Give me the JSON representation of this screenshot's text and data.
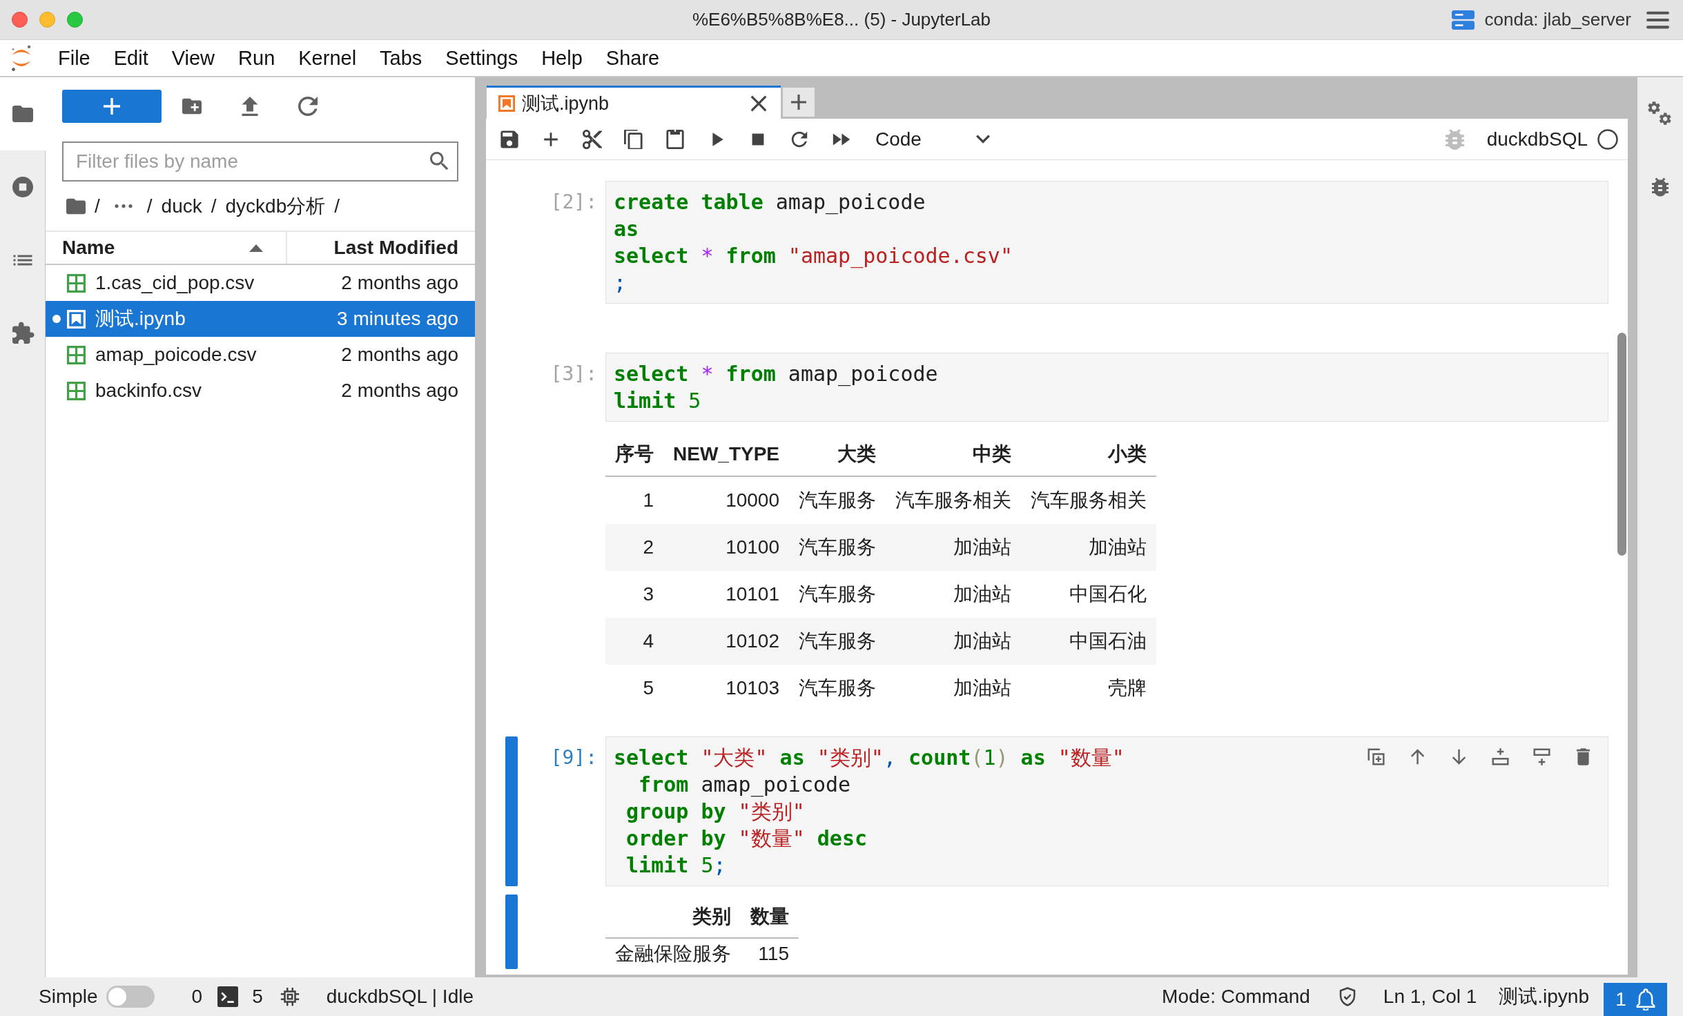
{
  "window": {
    "title": "%E6%B5%8B%E8... (5) - JupyterLab",
    "environment": "conda: jlab_server"
  },
  "menu_bar": [
    "File",
    "Edit",
    "View",
    "Run",
    "Kernel",
    "Tabs",
    "Settings",
    "Help",
    "Share"
  ],
  "left_sidebar": {
    "tabs": [
      {
        "kind": "files",
        "selected": true
      },
      {
        "kind": "running",
        "selected": false
      },
      {
        "kind": "toc",
        "selected": false
      },
      {
        "kind": "extensions",
        "selected": false
      }
    ]
  },
  "file_browser": {
    "filter": {
      "placeholder": "Filter files by name"
    },
    "breadcrumbs": [
      {
        "kind": "separator",
        "text": "/"
      },
      {
        "kind": "ellipsis"
      },
      {
        "kind": "separator",
        "text": "/"
      },
      {
        "kind": "folder",
        "text": "duck"
      },
      {
        "kind": "separator",
        "text": "/"
      },
      {
        "kind": "folder",
        "text": "dyckdb分析"
      },
      {
        "kind": "separator",
        "text": "/"
      }
    ],
    "columns": [
      {
        "label": "Name",
        "sorted": true
      },
      {
        "label": "Last Modified",
        "sorted": false
      }
    ],
    "files": [
      {
        "kind": "csv",
        "name": "1.cas_cid_pop.csv",
        "modified": "2 months ago",
        "selected": false,
        "open": false
      },
      {
        "kind": "notebook",
        "name": "测试.ipynb",
        "modified": "3 minutes ago",
        "selected": true,
        "open": true
      },
      {
        "kind": "csv",
        "name": "amap_poicode.csv",
        "modified": "2 months ago",
        "selected": false,
        "open": false
      },
      {
        "kind": "csv",
        "name": "backinfo.csv",
        "modified": "2 months ago",
        "selected": false,
        "open": false
      }
    ]
  },
  "tabs": [
    {
      "kind": "notebook",
      "label": "测试.ipynb",
      "selected": true
    }
  ],
  "notebook_toolbar": {
    "cell_type": "Code",
    "debugger_enabled": false,
    "kernel": "duckdbSQL",
    "kernel_busy": false
  },
  "cells": [
    {
      "prompt": "[2]:",
      "selected": false,
      "lines": [
        [
          {
            "kind": "keyword",
            "text": "create table"
          },
          {
            "kind": "plain",
            "text": " amap_poicode"
          }
        ],
        [
          {
            "kind": "keyword",
            "text": "as"
          }
        ],
        [
          {
            "kind": "keyword",
            "text": "select"
          },
          {
            "kind": "operator",
            "text": " * "
          },
          {
            "kind": "keyword",
            "text": "from"
          },
          {
            "kind": "string",
            "text": " \"amap_poicode.csv\""
          }
        ],
        [
          {
            "kind": "punct",
            "text": ";"
          }
        ]
      ]
    },
    {
      "prompt": "[3]:",
      "selected": false,
      "lines": [
        [
          {
            "kind": "keyword",
            "text": "select"
          },
          {
            "kind": "operator",
            "text": " * "
          },
          {
            "kind": "keyword",
            "text": "from"
          },
          {
            "kind": "plain",
            "text": " amap_poicode"
          }
        ],
        [
          {
            "kind": "keyword",
            "text": "limit"
          },
          {
            "kind": "number",
            "text": " 5"
          }
        ]
      ],
      "outputs": [
        {
          "kind": "table",
          "columns": [
            "序号",
            "NEW_TYPE",
            "大类",
            "中类",
            "小类"
          ],
          "rows": [
            [
              "1",
              "10000",
              "汽车服务",
              "汽车服务相关",
              "汽车服务相关"
            ],
            [
              "2",
              "10100",
              "汽车服务",
              "加油站",
              "加油站"
            ],
            [
              "3",
              "10101",
              "汽车服务",
              "加油站",
              "中国石化"
            ],
            [
              "4",
              "10102",
              "汽车服务",
              "加油站",
              "中国石油"
            ],
            [
              "5",
              "10103",
              "汽车服务",
              "加油站",
              "壳牌"
            ]
          ]
        }
      ]
    },
    {
      "prompt": "[9]:",
      "selected": true,
      "lines": [
        [
          {
            "kind": "keyword",
            "text": "select"
          },
          {
            "kind": "string",
            "text": " \"大类\""
          },
          {
            "kind": "keyword",
            "text": " as"
          },
          {
            "kind": "string",
            "text": " \"类别\""
          },
          {
            "kind": "punct",
            "text": ","
          },
          {
            "kind": "keyword",
            "text": " count"
          },
          {
            "kind": "bracket",
            "text": "("
          },
          {
            "kind": "number",
            "text": "1"
          },
          {
            "kind": "bracket",
            "text": ")"
          },
          {
            "kind": "keyword",
            "text": " as"
          },
          {
            "kind": "string",
            "text": " \"数量\""
          }
        ],
        [
          {
            "kind": "keyword",
            "text": "  from"
          },
          {
            "kind": "plain",
            "text": " amap_poicode"
          }
        ],
        [
          {
            "kind": "keyword",
            "text": " group by"
          },
          {
            "kind": "string",
            "text": " \"类别\""
          }
        ],
        [
          {
            "kind": "keyword",
            "text": " order by"
          },
          {
            "kind": "string",
            "text": " \"数量\""
          },
          {
            "kind": "keyword",
            "text": " desc"
          }
        ],
        [
          {
            "kind": "keyword",
            "text": " limit"
          },
          {
            "kind": "number",
            "text": " 5"
          },
          {
            "kind": "punct",
            "text": ";"
          }
        ]
      ],
      "outputs": [
        {
          "kind": "table",
          "columns": [
            "类别",
            "数量"
          ],
          "rows": [
            [
              "金融保险服务",
              "115"
            ]
          ]
        }
      ]
    }
  ],
  "right_sidebar": {
    "tabs": [
      {
        "kind": "property_inspector",
        "selected": false
      },
      {
        "kind": "debugger",
        "selected": false
      }
    ]
  },
  "status_bar": {
    "simple_mode": {
      "label": "Simple",
      "on": false
    },
    "terminals": "0",
    "kernels": "5",
    "kernel_status": "duckdbSQL | Idle",
    "mode": "Mode: Command",
    "cursor": "Ln 1, Col 1",
    "file": "测试.ipynb",
    "notifications": "1"
  }
}
